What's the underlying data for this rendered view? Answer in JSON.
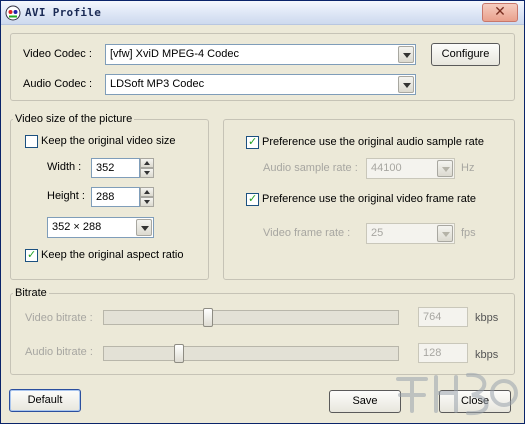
{
  "window": {
    "title": "AVI Profile",
    "close_glyph": "✕"
  },
  "codecs": {
    "video_label": "Video Codec :",
    "video_value": "[vfw] XviD MPEG-4 Codec",
    "audio_label": "Audio Codec :",
    "audio_value": "LDSoft MP3 Codec",
    "configure_label": "Configure"
  },
  "video_size": {
    "group_title": "Video size of the picture",
    "keep_original_label": "Keep the original video size",
    "keep_original_checked": false,
    "width_label": "Width :",
    "width_value": "352",
    "height_label": "Height :",
    "height_value": "288",
    "preset_value": "352 × 288",
    "keep_aspect_label": "Keep the original aspect ratio",
    "keep_aspect_checked": true
  },
  "audio_video_rates": {
    "pref_audio_label": "Preference use the original audio sample rate",
    "pref_audio_checked": true,
    "sample_rate_label": "Audio sample rate :",
    "sample_rate_value": "44100",
    "sample_rate_unit": "Hz",
    "pref_frame_label": "Preference use the original video frame rate",
    "pref_frame_checked": true,
    "frame_rate_label": "Video frame rate :",
    "frame_rate_value": "25",
    "frame_rate_unit": "fps"
  },
  "bitrate": {
    "group_title": "Bitrate",
    "video_label": "Video bitrate :",
    "video_value": "764",
    "video_unit": "kbps",
    "video_slider_fraction": 0.35,
    "audio_label": "Audio bitrate :",
    "audio_value": "128",
    "audio_unit": "kbps",
    "audio_slider_fraction": 0.245
  },
  "footer": {
    "default_label": "Default",
    "save_label": "Save",
    "close_label": "Close"
  },
  "colors": {
    "titlebar_text": "#1a2a55",
    "disabled_text": "#a7a6a1",
    "check_mark": "#21a121"
  },
  "icons": {
    "title": "app-logo-icon",
    "close": "close-icon"
  }
}
